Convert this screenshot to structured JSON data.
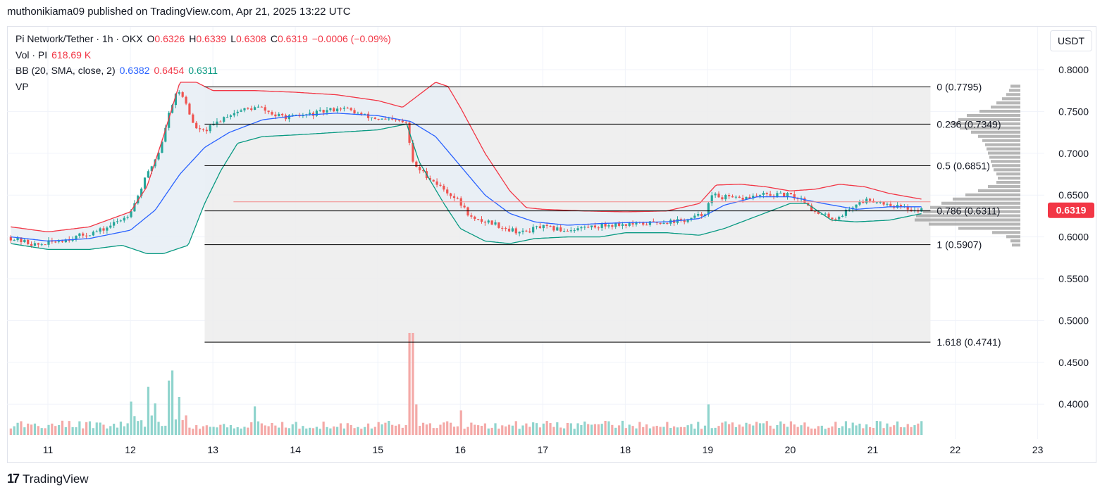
{
  "header": {
    "publisher_line": "muthonikiama09 published on TradingView.com, Apr 21, 2025 13:22 UTC"
  },
  "legend": {
    "symbol": "Pi Network/Tether · 1h · OKX",
    "o_label": "O",
    "o_value": "0.6326",
    "h_label": "H",
    "h_value": "0.6339",
    "l_label": "L",
    "l_value": "0.6308",
    "c_label": "C",
    "c_value": "0.6319",
    "change": "−0.0006 (−0.09%)",
    "vol_label": "Vol · PI",
    "vol_value": "618.69 K",
    "bb_label": "BB (20, SMA, close, 2)",
    "bb_basis": "0.6382",
    "bb_upper": "0.6454",
    "bb_lower": "0.6311",
    "vp_label": "VP"
  },
  "currency_button": "USDT",
  "colors": {
    "up": "#26a69a",
    "down": "#ef5350",
    "vol_up": "#8fd4cd",
    "vol_down": "#f4a9a7",
    "bb_upper": "#f23645",
    "bb_lower": "#089981",
    "bb_basis": "#2962ff",
    "bb_fill": "#e8eef5",
    "fib_fill": "#ececec",
    "fib_line": "#000000",
    "price_tag": "#f23645",
    "grid": "#f0f3fa"
  },
  "chart_data": {
    "type": "candlestick",
    "title": "Pi Network/Tether · 1h · OKX",
    "xlabel": "",
    "ylabel": "",
    "ylim": [
      0.355,
      0.815
    ],
    "xlim": [
      10.55,
      23.15
    ],
    "y_ticks": [
      "0.8000",
      "0.7500",
      "0.7000",
      "0.6500",
      "0.6000",
      "0.5500",
      "0.5000",
      "0.4500",
      "0.4000"
    ],
    "x_ticks": [
      "11",
      "12",
      "13",
      "14",
      "15",
      "16",
      "17",
      "18",
      "19",
      "20",
      "21",
      "22",
      "23"
    ],
    "last_price": "0.6319",
    "current_price": 0.6319,
    "horizontal_line": 0.642,
    "fibonacci": {
      "x_start": 12.9,
      "x_end": 21.7,
      "levels": [
        {
          "ratio": 0,
          "price": 0.7795,
          "label": "0 (0.7795)"
        },
        {
          "ratio": 0.236,
          "price": 0.7349,
          "label": "0.236 (0.7349)"
        },
        {
          "ratio": 0.5,
          "price": 0.6851,
          "label": "0.5 (0.6851)"
        },
        {
          "ratio": 0.786,
          "price": 0.6311,
          "label": "0.786 (0.6311)"
        },
        {
          "ratio": 1,
          "price": 0.5907,
          "label": "1 (0.5907)"
        },
        {
          "ratio": 1.618,
          "price": 0.4741,
          "label": "1.618 (0.4741)"
        }
      ]
    },
    "price_path": [
      [
        10.55,
        0.6
      ],
      [
        10.9,
        0.59
      ],
      [
        11.3,
        0.598
      ],
      [
        11.7,
        0.608
      ],
      [
        12.0,
        0.625
      ],
      [
        12.1,
        0.642
      ],
      [
        12.2,
        0.665
      ],
      [
        12.3,
        0.685
      ],
      [
        12.4,
        0.705
      ],
      [
        12.5,
        0.745
      ],
      [
        12.6,
        0.775
      ],
      [
        12.7,
        0.765
      ],
      [
        12.8,
        0.735
      ],
      [
        12.9,
        0.725
      ],
      [
        13.0,
        0.73
      ],
      [
        13.2,
        0.745
      ],
      [
        13.4,
        0.752
      ],
      [
        13.6,
        0.755
      ],
      [
        13.8,
        0.745
      ],
      [
        14.0,
        0.743
      ],
      [
        14.3,
        0.748
      ],
      [
        14.6,
        0.755
      ],
      [
        14.9,
        0.744
      ],
      [
        15.1,
        0.74
      ],
      [
        15.3,
        0.738
      ],
      [
        15.4,
        0.735
      ],
      [
        15.45,
        0.69
      ],
      [
        15.55,
        0.68
      ],
      [
        15.8,
        0.66
      ],
      [
        16.0,
        0.645
      ],
      [
        16.2,
        0.62
      ],
      [
        16.4,
        0.618
      ],
      [
        16.6,
        0.61
      ],
      [
        16.8,
        0.605
      ],
      [
        17.0,
        0.612
      ],
      [
        17.3,
        0.608
      ],
      [
        17.6,
        0.612
      ],
      [
        17.9,
        0.615
      ],
      [
        18.2,
        0.615
      ],
      [
        18.5,
        0.618
      ],
      [
        18.8,
        0.62
      ],
      [
        19.0,
        0.628
      ],
      [
        19.1,
        0.65
      ],
      [
        19.2,
        0.648
      ],
      [
        19.4,
        0.645
      ],
      [
        19.7,
        0.65
      ],
      [
        20.0,
        0.65
      ],
      [
        20.2,
        0.645
      ],
      [
        20.35,
        0.628
      ],
      [
        20.6,
        0.622
      ],
      [
        20.85,
        0.64
      ],
      [
        21.0,
        0.645
      ],
      [
        21.2,
        0.64
      ],
      [
        21.4,
        0.635
      ],
      [
        21.6,
        0.632
      ]
    ],
    "bb_upper_path": [
      [
        10.55,
        0.612
      ],
      [
        11.0,
        0.606
      ],
      [
        11.5,
        0.612
      ],
      [
        12.0,
        0.63
      ],
      [
        12.2,
        0.66
      ],
      [
        12.4,
        0.72
      ],
      [
        12.6,
        0.785
      ],
      [
        12.8,
        0.785
      ],
      [
        13.0,
        0.775
      ],
      [
        13.5,
        0.775
      ],
      [
        14.0,
        0.773
      ],
      [
        14.5,
        0.77
      ],
      [
        15.0,
        0.763
      ],
      [
        15.3,
        0.755
      ],
      [
        15.5,
        0.77
      ],
      [
        15.7,
        0.785
      ],
      [
        15.85,
        0.78
      ],
      [
        16.0,
        0.755
      ],
      [
        16.3,
        0.7
      ],
      [
        16.6,
        0.655
      ],
      [
        16.8,
        0.635
      ],
      [
        17.0,
        0.633
      ],
      [
        17.5,
        0.631
      ],
      [
        18.0,
        0.63
      ],
      [
        18.5,
        0.631
      ],
      [
        18.9,
        0.64
      ],
      [
        19.1,
        0.662
      ],
      [
        19.4,
        0.663
      ],
      [
        19.7,
        0.66
      ],
      [
        20.0,
        0.655
      ],
      [
        20.3,
        0.657
      ],
      [
        20.6,
        0.663
      ],
      [
        20.9,
        0.66
      ],
      [
        21.2,
        0.652
      ],
      [
        21.6,
        0.645
      ]
    ],
    "bb_lower_path": [
      [
        10.55,
        0.592
      ],
      [
        11.0,
        0.585
      ],
      [
        11.5,
        0.585
      ],
      [
        11.9,
        0.59
      ],
      [
        12.2,
        0.58
      ],
      [
        12.4,
        0.58
      ],
      [
        12.7,
        0.59
      ],
      [
        12.9,
        0.64
      ],
      [
        13.1,
        0.68
      ],
      [
        13.3,
        0.712
      ],
      [
        13.6,
        0.72
      ],
      [
        14.0,
        0.722
      ],
      [
        14.5,
        0.725
      ],
      [
        15.0,
        0.728
      ],
      [
        15.35,
        0.735
      ],
      [
        15.5,
        0.69
      ],
      [
        15.8,
        0.64
      ],
      [
        16.0,
        0.61
      ],
      [
        16.3,
        0.595
      ],
      [
        16.6,
        0.592
      ],
      [
        16.9,
        0.598
      ],
      [
        17.3,
        0.6
      ],
      [
        17.7,
        0.6
      ],
      [
        18.0,
        0.605
      ],
      [
        18.5,
        0.605
      ],
      [
        18.9,
        0.602
      ],
      [
        19.2,
        0.61
      ],
      [
        19.6,
        0.625
      ],
      [
        20.0,
        0.64
      ],
      [
        20.2,
        0.64
      ],
      [
        20.5,
        0.62
      ],
      [
        20.8,
        0.618
      ],
      [
        21.2,
        0.62
      ],
      [
        21.6,
        0.628
      ]
    ],
    "bb_basis_path": [
      [
        10.55,
        0.6
      ],
      [
        11.0,
        0.595
      ],
      [
        11.5,
        0.598
      ],
      [
        12.0,
        0.608
      ],
      [
        12.3,
        0.632
      ],
      [
        12.6,
        0.675
      ],
      [
        12.9,
        0.707
      ],
      [
        13.2,
        0.725
      ],
      [
        13.6,
        0.74
      ],
      [
        14.0,
        0.745
      ],
      [
        14.5,
        0.748
      ],
      [
        15.0,
        0.745
      ],
      [
        15.4,
        0.738
      ],
      [
        15.7,
        0.72
      ],
      [
        16.0,
        0.685
      ],
      [
        16.3,
        0.65
      ],
      [
        16.6,
        0.628
      ],
      [
        16.9,
        0.618
      ],
      [
        17.3,
        0.614
      ],
      [
        17.7,
        0.616
      ],
      [
        18.0,
        0.617
      ],
      [
        18.5,
        0.618
      ],
      [
        18.9,
        0.622
      ],
      [
        19.2,
        0.638
      ],
      [
        19.6,
        0.648
      ],
      [
        20.0,
        0.648
      ],
      [
        20.4,
        0.64
      ],
      [
        20.8,
        0.633
      ],
      [
        21.2,
        0.636
      ],
      [
        21.6,
        0.636
      ]
    ],
    "volume_spikes": [
      [
        12.45,
        0.42
      ],
      [
        12.5,
        0.52
      ],
      [
        12.2,
        0.38
      ],
      [
        13.5,
        0.28
      ],
      [
        15.4,
        1.0
      ],
      [
        15.45,
        0.3
      ],
      [
        16.0,
        0.24
      ],
      [
        19.0,
        0.3
      ],
      [
        12.0,
        0.22
      ],
      [
        12.6,
        0.3
      ],
      [
        12.3,
        0.26
      ]
    ],
    "volume_profile": [
      [
        0.78,
        14
      ],
      [
        0.775,
        16
      ],
      [
        0.77,
        20
      ],
      [
        0.765,
        26
      ],
      [
        0.76,
        34
      ],
      [
        0.755,
        42
      ],
      [
        0.75,
        58
      ],
      [
        0.745,
        76
      ],
      [
        0.74,
        88
      ],
      [
        0.735,
        100
      ],
      [
        0.73,
        86
      ],
      [
        0.725,
        70
      ],
      [
        0.72,
        60
      ],
      [
        0.715,
        54
      ],
      [
        0.71,
        50
      ],
      [
        0.705,
        48
      ],
      [
        0.7,
        46
      ],
      [
        0.695,
        44
      ],
      [
        0.69,
        42
      ],
      [
        0.685,
        40
      ],
      [
        0.68,
        38
      ],
      [
        0.675,
        34
      ],
      [
        0.67,
        32
      ],
      [
        0.665,
        34
      ],
      [
        0.66,
        46
      ],
      [
        0.655,
        60
      ],
      [
        0.65,
        78
      ],
      [
        0.645,
        96
      ],
      [
        0.64,
        112
      ],
      [
        0.635,
        128
      ],
      [
        0.63,
        138
      ],
      [
        0.625,
        148
      ],
      [
        0.62,
        150
      ],
      [
        0.615,
        130
      ],
      [
        0.61,
        88
      ],
      [
        0.605,
        40
      ],
      [
        0.6,
        20
      ],
      [
        0.595,
        14
      ],
      [
        0.59,
        12
      ]
    ]
  },
  "footer": {
    "brand_icon": "17",
    "brand_name": "TradingView"
  }
}
